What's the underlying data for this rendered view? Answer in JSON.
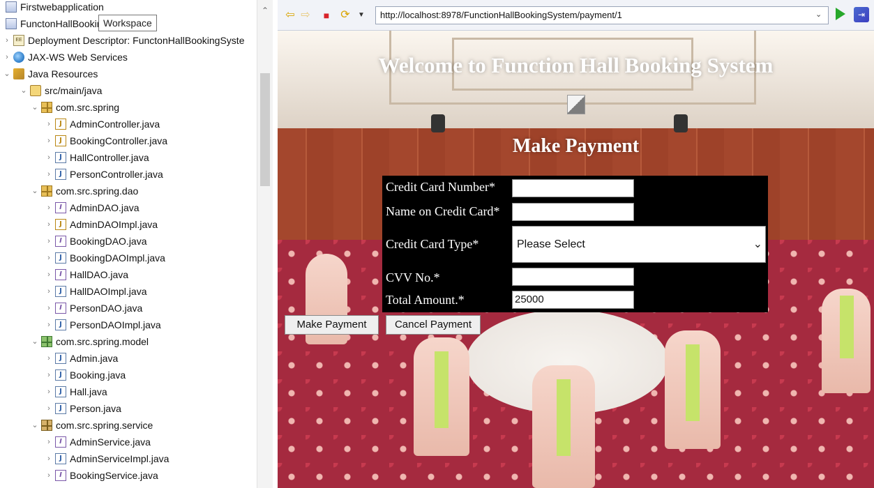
{
  "explorer": {
    "tooltip": "Workspace",
    "items": [
      {
        "label": "Firstwebapplication",
        "icon": "project-icon"
      },
      {
        "label": "FunctonHallBookingSystem",
        "icon": "project-icon"
      },
      {
        "label": "Deployment Descriptor: FunctonHallBookingSyste",
        "icon": "deployment-descriptor-icon"
      },
      {
        "label": "JAX-WS Web Services",
        "icon": "web-services-icon"
      },
      {
        "label": "Java Resources",
        "icon": "java-resources-icon"
      },
      {
        "label": "src/main/java",
        "icon": "source-folder-icon"
      },
      {
        "label": "com.src.spring",
        "icon": "package-icon"
      },
      {
        "label": "AdminController.java",
        "icon": "java-class-icon"
      },
      {
        "label": "BookingController.java",
        "icon": "java-class-icon"
      },
      {
        "label": "HallController.java",
        "icon": "java-class-icon"
      },
      {
        "label": "PersonController.java",
        "icon": "java-class-icon"
      },
      {
        "label": "com.src.spring.dao",
        "icon": "package-icon"
      },
      {
        "label": "AdminDAO.java",
        "icon": "java-interface-icon"
      },
      {
        "label": "AdminDAOImpl.java",
        "icon": "java-class-icon"
      },
      {
        "label": "BookingDAO.java",
        "icon": "java-interface-icon"
      },
      {
        "label": "BookingDAOImpl.java",
        "icon": "java-class-icon"
      },
      {
        "label": "HallDAO.java",
        "icon": "java-interface-icon"
      },
      {
        "label": "HallDAOImpl.java",
        "icon": "java-class-icon"
      },
      {
        "label": "PersonDAO.java",
        "icon": "java-interface-icon"
      },
      {
        "label": "PersonDAOImpl.java",
        "icon": "java-class-icon"
      },
      {
        "label": "com.src.spring.model",
        "icon": "package-icon"
      },
      {
        "label": "Admin.java",
        "icon": "java-class-icon"
      },
      {
        "label": "Booking.java",
        "icon": "java-class-icon"
      },
      {
        "label": "Hall.java",
        "icon": "java-class-icon"
      },
      {
        "label": "Person.java",
        "icon": "java-class-icon"
      },
      {
        "label": "com.src.spring.service",
        "icon": "package-icon"
      },
      {
        "label": "AdminService.java",
        "icon": "java-interface-icon"
      },
      {
        "label": "AdminServiceImpl.java",
        "icon": "java-class-icon"
      },
      {
        "label": "BookingService.java",
        "icon": "java-interface-icon"
      }
    ]
  },
  "browser": {
    "url": "http://localhost:8978/FunctionHallBookingSystem/payment/1",
    "icons": {
      "back": "back-arrow-icon",
      "forward": "forward-arrow-icon",
      "stop": "stop-icon",
      "refresh": "refresh-icon",
      "go": "go-icon"
    }
  },
  "page": {
    "welcome_title": "Welcome to Function Hall Booking System",
    "heading": "Make Payment",
    "form": {
      "card_number_label": "Credit Card Number*",
      "card_number_value": "",
      "name_label": "Name on Credit Card*",
      "name_value": "",
      "card_type_label": "Credit Card Type*",
      "card_type_selected": "Please Select",
      "cvv_label": "CVV No.*",
      "cvv_value": "",
      "total_label": "Total Amount.*",
      "total_value": "25000"
    },
    "make_payment_button": "Make Payment",
    "cancel_payment_button": "Cancel Payment"
  },
  "colors": {
    "form_background": "#000000",
    "go_button": "#27a82b",
    "stop_button": "#d8232a"
  }
}
